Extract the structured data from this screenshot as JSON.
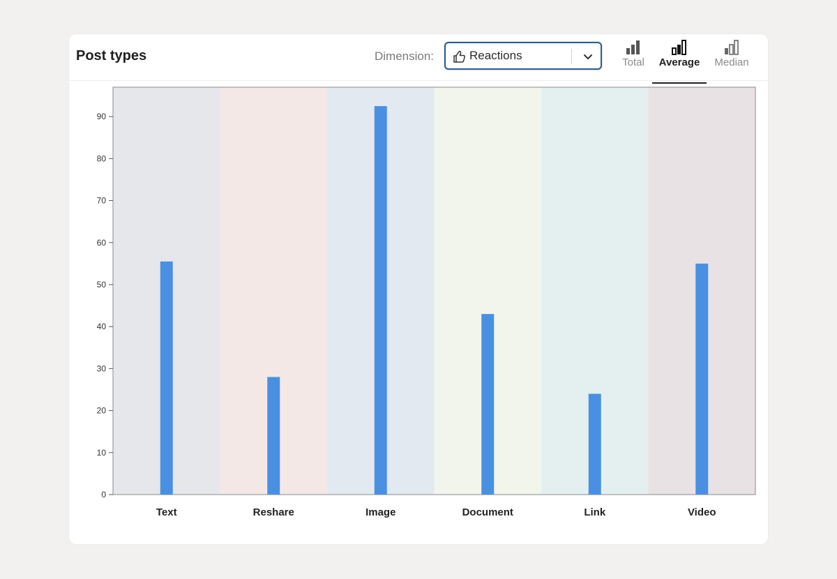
{
  "header": {
    "title": "Post types",
    "dimension_label": "Dimension:",
    "dimension_value": "Reactions",
    "aggregations": [
      {
        "label": "Total",
        "active": false
      },
      {
        "label": "Average",
        "active": true
      },
      {
        "label": "Median",
        "active": false
      }
    ]
  },
  "colors": {
    "bar": "#4a90e2",
    "bands": [
      "#e6e7eb",
      "#f4e8e7",
      "#e3e9f1",
      "#f1f5ec",
      "#e4f0ef",
      "#e9e2e5"
    ]
  },
  "chart_data": {
    "type": "bar",
    "categories": [
      "Text",
      "Reshare",
      "Image",
      "Document",
      "Link",
      "Video"
    ],
    "values": [
      55.5,
      28,
      92.5,
      43,
      24,
      55
    ],
    "xlabel": "",
    "ylabel": "",
    "ylim": [
      0,
      97
    ],
    "yticks": [
      0,
      10,
      20,
      30,
      40,
      50,
      60,
      70,
      80,
      90
    ],
    "grid": false,
    "legend": "none"
  }
}
